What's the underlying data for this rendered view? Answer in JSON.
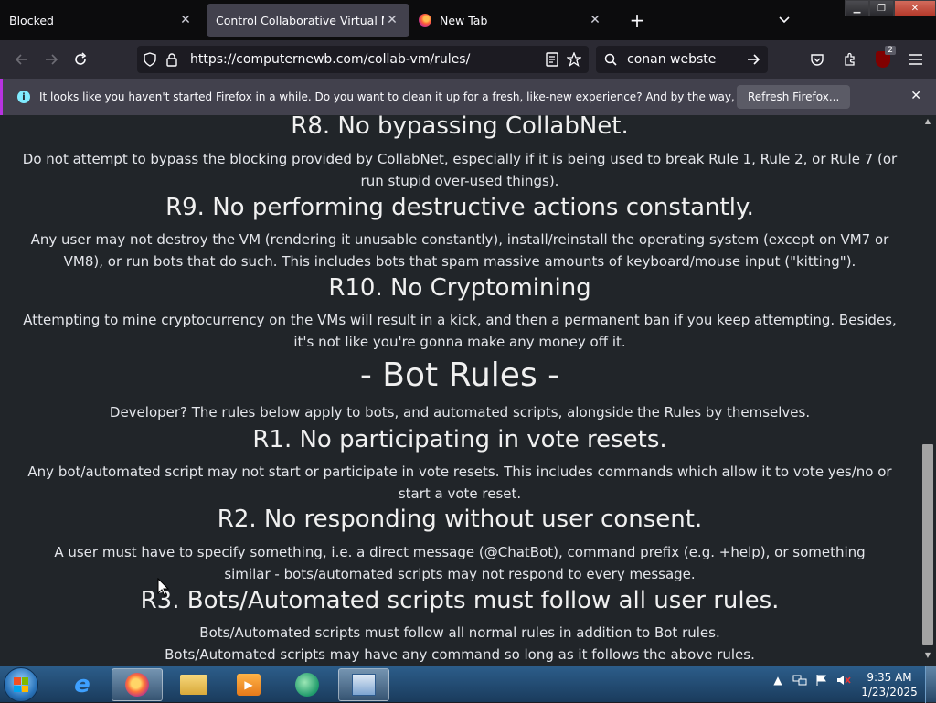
{
  "browser": {
    "tabs": [
      {
        "label": "Blocked",
        "active": false
      },
      {
        "label": "Control Collaborative Virtual Machi",
        "active": true
      },
      {
        "label": "New Tab",
        "active": false
      }
    ],
    "url": "https://computernewb.com/collab-vm/rules/",
    "search_value": "conan webste",
    "extension_badge": "2",
    "notification": {
      "text": "It looks like you haven't started Firefox in a while. Do you want to clean it up for a fresh, like-new experience? And by the way, welcome back!",
      "button_label": "Refresh Firefox..."
    }
  },
  "page": {
    "rules": [
      {
        "title": "R8. No bypassing CollabNet.",
        "text": "Do not attempt to bypass the blocking provided by CollabNet, especially if it is being used to break Rule 1, Rule 2, or Rule 7 (or run stupid over-used things)."
      },
      {
        "title": "R9. No performing destructive actions constantly.",
        "text": "Any user may not destroy the VM (rendering it unusable constantly), install/reinstall the operating system (except on VM7 or VM8), or run bots that do such. This includes bots that spam massive amounts of keyboard/mouse input (\"kitting\")."
      },
      {
        "title": "R10. No Cryptomining",
        "text": "Attempting to mine cryptocurrency on the VMs will result in a kick, and then a permanent ban if you keep attempting. Besides, it's not like you're gonna make any money off it."
      }
    ],
    "bot_section": {
      "title": "- Bot Rules -",
      "intro": "Developer? The rules below apply to bots, and automated scripts, alongside the Rules by themselves."
    },
    "bot_rules": [
      {
        "title": "R1. No participating in vote resets.",
        "text": "Any bot/automated script may not start or participate in vote resets. This includes commands which allow it to vote yes/no or start a vote reset."
      },
      {
        "title": "R2. No responding without user consent.",
        "text": "A user must have to specify something, i.e. a direct message (@ChatBot), command prefix (e.g. +help), or something similar - bots/automated scripts may not respond to every message."
      },
      {
        "title": "R3. Bots/Automated scripts must follow all user rules.",
        "text_1": "Bots/Automated scripts must follow all normal rules in addition to Bot rules.",
        "text_2": "Bots/Automated scripts may have any command so long as it follows the above rules."
      }
    ]
  },
  "taskbar": {
    "time": "9:35 AM",
    "date": "1/23/2025",
    "pinned": [
      "internet-explorer",
      "firefox",
      "file-explorer",
      "media-player",
      "chat-app",
      "remote-desktop"
    ]
  }
}
